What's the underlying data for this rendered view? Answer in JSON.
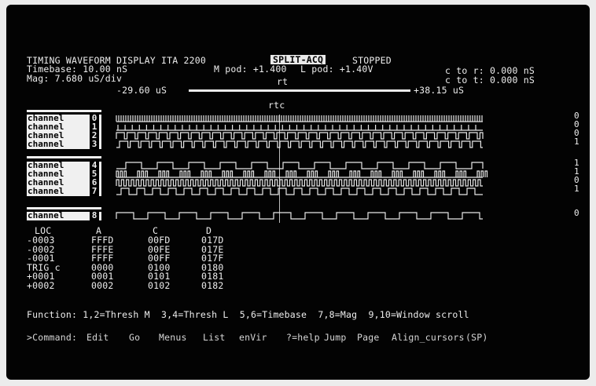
{
  "header": {
    "title": "TIMING WAVEFORM DISPLAY ITA 2200",
    "mode": "SPLIT-ACQ",
    "state": "STOPPED",
    "timebase": "Timebase: 10.00 nS",
    "m_pod": "M pod: +1.400",
    "l_pod": "L pod: +1.40V",
    "c_to_r": "c to r: 0.000 nS",
    "mag": "Mag: 7.680 uS/div",
    "rt": "rt",
    "c_to_t": "c to t: 0.000 nS",
    "range_left": "-29.60 uS",
    "range_right": "+38.15 uS",
    "rtc": "rtc"
  },
  "channels": [
    {
      "name": "channel",
      "num": "0",
      "level": "0",
      "pattern": "dense"
    },
    {
      "name": "channel",
      "num": "1",
      "level": "0",
      "pattern": "spikes"
    },
    {
      "name": "channel",
      "num": "2",
      "level": "0",
      "pattern": "pulse12"
    },
    {
      "name": "channel",
      "num": "3",
      "level": "1",
      "pattern": "pulse12b"
    },
    {
      "name": "channel",
      "num": "4",
      "level": "1",
      "pattern": "square6"
    },
    {
      "name": "channel",
      "num": "5",
      "level": "1",
      "pattern": "clustered"
    },
    {
      "name": "channel",
      "num": "6",
      "level": "0",
      "pattern": "square30"
    },
    {
      "name": "channel",
      "num": "7",
      "level": "1",
      "pattern": "square12"
    },
    {
      "name": "channel",
      "num": "8",
      "level": "0",
      "pattern": "square6b"
    }
  ],
  "table": {
    "headers": [
      "LOC",
      "A",
      "C",
      "D"
    ],
    "rows": [
      [
        "-0003",
        "FFFD",
        "00FD",
        "017D"
      ],
      [
        "-0002",
        "FFFE",
        "00FE",
        "017E"
      ],
      [
        "-0001",
        "FFFF",
        "00FF",
        "017F"
      ],
      [
        "TRIG c",
        "0000",
        "0100",
        "0180"
      ],
      [
        "+0001",
        "0001",
        "0101",
        "0181"
      ],
      [
        "+0002",
        "0002",
        "0102",
        "0182"
      ]
    ]
  },
  "function_line": "Function: 1,2=Thresh M  3,4=Thresh L  5,6=Timebase  7,8=Mag  9,10=Window scroll",
  "command": {
    "prompt": ">Command:",
    "items": [
      "Edit",
      "Go",
      "Menus",
      "List",
      "enVir",
      "?=help",
      "Jump",
      "Page",
      "Align_cursors",
      "(SP)"
    ]
  }
}
